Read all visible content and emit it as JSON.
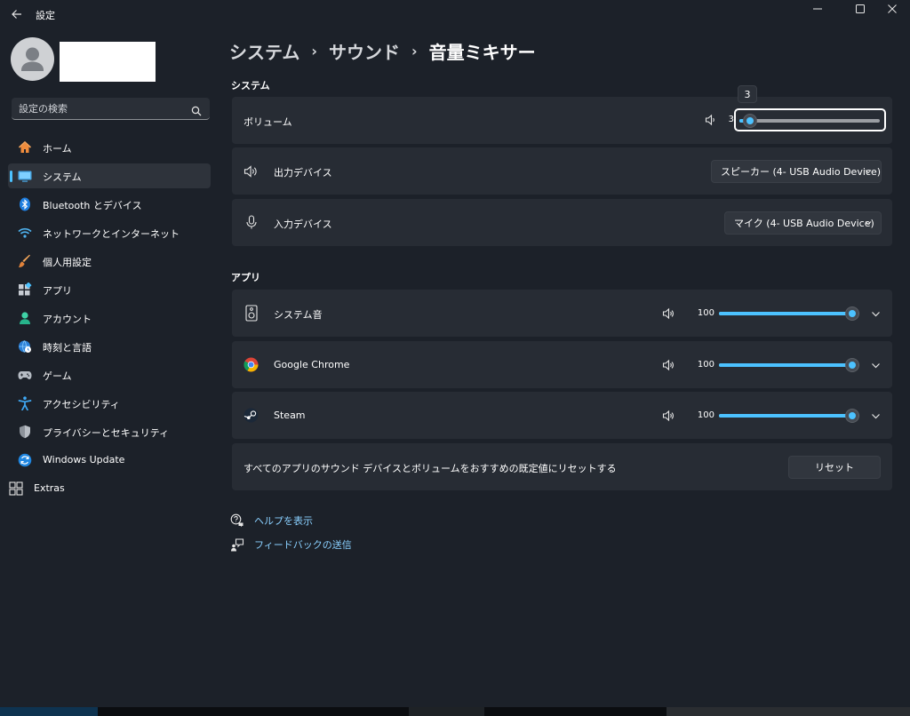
{
  "window": {
    "title": "設定"
  },
  "colors": {
    "accent": "#4cc2ff",
    "background": "#1c2129",
    "card": "#272c34",
    "link": "#8ad0ff"
  },
  "sidebar": {
    "search": {
      "placeholder": "設定の検索",
      "value": ""
    },
    "items": [
      {
        "label": "ホーム",
        "icon": "home-icon",
        "active": false
      },
      {
        "label": "システム",
        "icon": "monitor-icon",
        "active": true
      },
      {
        "label": "Bluetooth とデバイス",
        "icon": "bluetooth-icon",
        "active": false
      },
      {
        "label": "ネットワークとインターネット",
        "icon": "wifi-icon",
        "active": false
      },
      {
        "label": "個人用設定",
        "icon": "brush-icon",
        "active": false
      },
      {
        "label": "アプリ",
        "icon": "apps-icon",
        "active": false
      },
      {
        "label": "アカウント",
        "icon": "person-icon",
        "active": false
      },
      {
        "label": "時刻と言語",
        "icon": "globe-clock-icon",
        "active": false
      },
      {
        "label": "ゲーム",
        "icon": "gamepad-icon",
        "active": false
      },
      {
        "label": "アクセシビリティ",
        "icon": "accessibility-icon",
        "active": false
      },
      {
        "label": "プライバシーとセキュリティ",
        "icon": "shield-icon",
        "active": false
      },
      {
        "label": "Windows Update",
        "icon": "update-icon",
        "active": false
      },
      {
        "label": "Extras",
        "icon": "extras-icon",
        "active": false
      }
    ]
  },
  "breadcrumb": [
    "システム",
    "サウンド",
    "音量ミキサー"
  ],
  "system_section": {
    "title": "システム",
    "volume": {
      "label": "ボリューム",
      "value": "3",
      "tooltip": "3",
      "level": 3
    },
    "output": {
      "label": "出力デバイス",
      "selected": "スピーカー (4- USB Audio Device)"
    },
    "input": {
      "label": "入力デバイス",
      "selected": "マイク (4- USB Audio Device)"
    }
  },
  "apps_section": {
    "title": "アプリ",
    "apps": [
      {
        "name": "システム音",
        "icon": "system-sounds-icon",
        "volume": "100",
        "level": 100
      },
      {
        "name": "Google Chrome",
        "icon": "chrome-icon",
        "volume": "100",
        "level": 100
      },
      {
        "name": "Steam",
        "icon": "steam-icon",
        "volume": "100",
        "level": 100
      }
    ],
    "reset": {
      "text": "すべてのアプリのサウンド デバイスとボリュームをおすすめの既定値にリセットする",
      "button": "リセット"
    }
  },
  "links": {
    "help": "ヘルプを表示",
    "feedback": "フィードバックの送信"
  }
}
